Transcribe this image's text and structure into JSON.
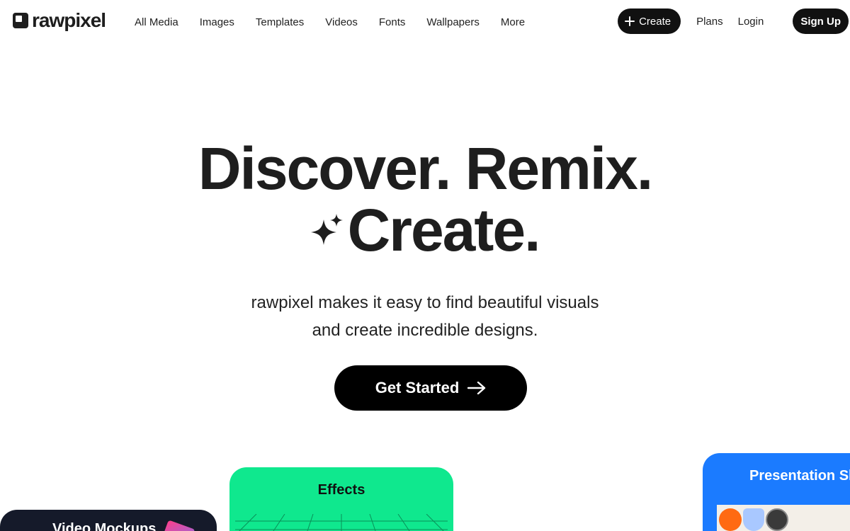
{
  "header": {
    "logo_text": "rawpixel",
    "nav": [
      "All Media",
      "Images",
      "Templates",
      "Videos",
      "Fonts",
      "Wallpapers",
      "More"
    ],
    "create_label": "Create",
    "plans_label": "Plans",
    "login_label": "Login",
    "signup_label": "Sign Up"
  },
  "hero": {
    "title_line1": "Discover. Remix.",
    "title_line2": "Create.",
    "subtitle_line1": "rawpixel makes it easy to find beautiful visuals",
    "subtitle_line2": "and create incredible designs.",
    "cta_label": "Get Started"
  },
  "cards": {
    "video": "Video Mockups",
    "effects": "Effects",
    "presentation": "Presentation Slides"
  },
  "colors": {
    "ink": "#1e1e1e",
    "effects_green": "#0fe88e",
    "presentation_blue": "#1b7bff",
    "video_dark": "#151a2a"
  }
}
